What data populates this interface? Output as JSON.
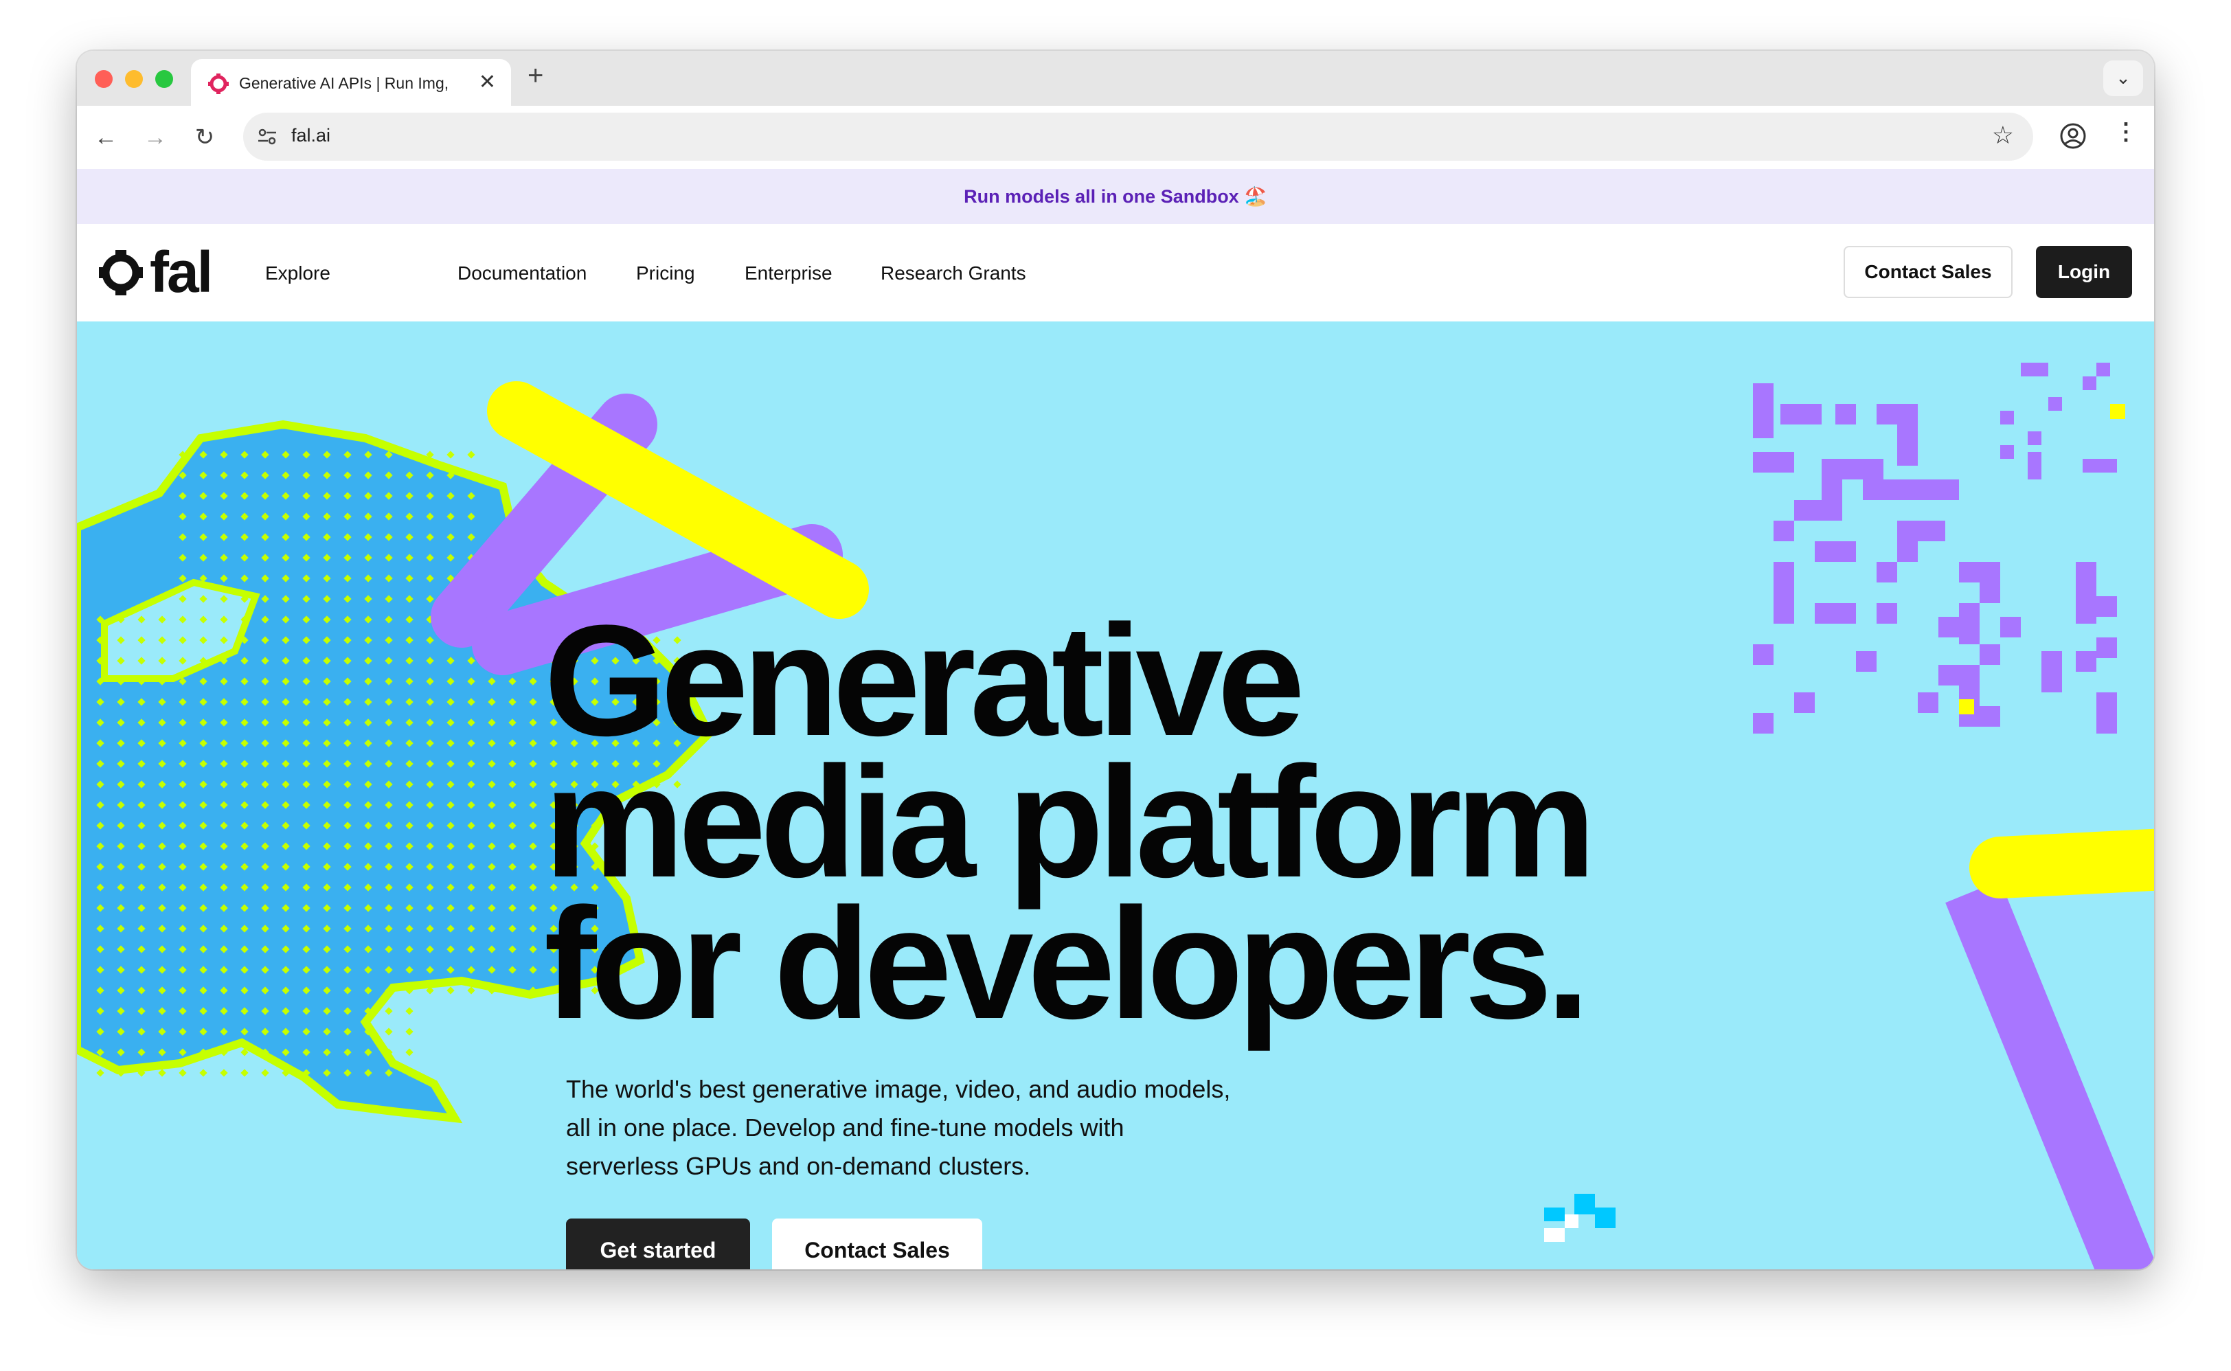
{
  "browser": {
    "tab_title": "Generative AI APIs | Run Img,",
    "url": "fal.ai",
    "new_tab_symbol": "+",
    "tab_close_symbol": "✕",
    "tab_menu_symbol": "⌄"
  },
  "banner": {
    "text": "Run models all in one Sandbox 🏖️"
  },
  "nav": {
    "logo_text": "fal",
    "links": [
      "Explore",
      "Documentation",
      "Pricing",
      "Enterprise",
      "Research Grants"
    ],
    "contact_sales": "Contact Sales",
    "login": "Login"
  },
  "hero": {
    "title_lines": [
      "Generative",
      "media platform",
      "for developers."
    ],
    "subtitle": "The world's best generative image, video, and audio models, all in one place. Develop and fine-tune models with serverless GPUs and on-demand clusters.",
    "cta_primary": "Get started",
    "cta_secondary": "Contact Sales"
  },
  "colors": {
    "hero_bg": "#9aeafa",
    "yellow": "#ffff00",
    "purple": "#a876ff",
    "blob_blue": "#3ab0f0",
    "lime": "#c6ff00",
    "banner_text": "#5b21b6"
  },
  "icons": [
    "back-arrow-icon",
    "forward-arrow-icon",
    "reload-icon",
    "site-settings-icon",
    "bookmark-star-icon",
    "profile-icon",
    "more-menu-icon",
    "fal-logo-icon"
  ]
}
